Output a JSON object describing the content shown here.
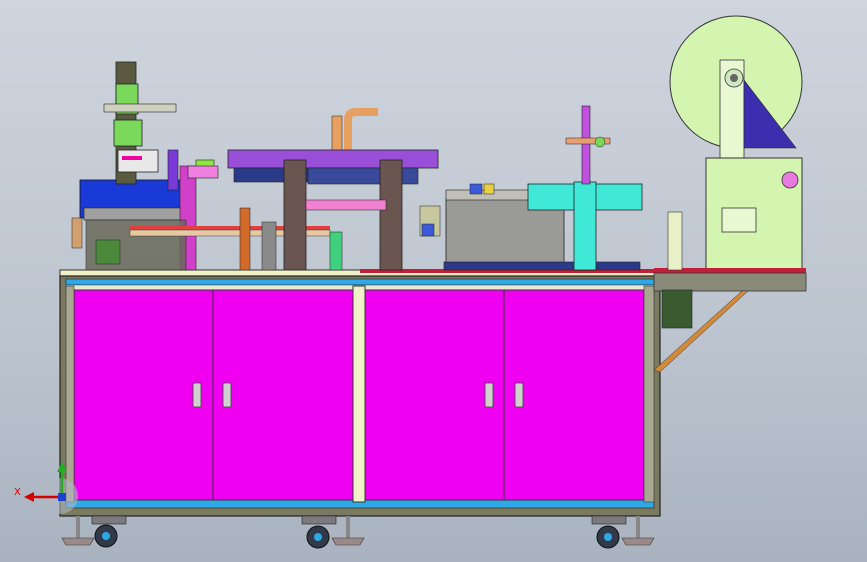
{
  "view": {
    "axis_triad": {
      "x_label": "X"
    }
  },
  "colors": {
    "background_top": "#cfd5dd",
    "cabinet_panel": "#f000f0",
    "frame_gray": "#7a7a60",
    "rail_blue": "#2fa8e8",
    "roll_disc": "#d4f5b0",
    "blue_arm": "#3b2fb0",
    "gantry_violet": "#9a4fd8",
    "conveyor_gray": "#9a9a96",
    "cyan_head": "#40e8d8",
    "brace_orange": "#d28a3a"
  }
}
